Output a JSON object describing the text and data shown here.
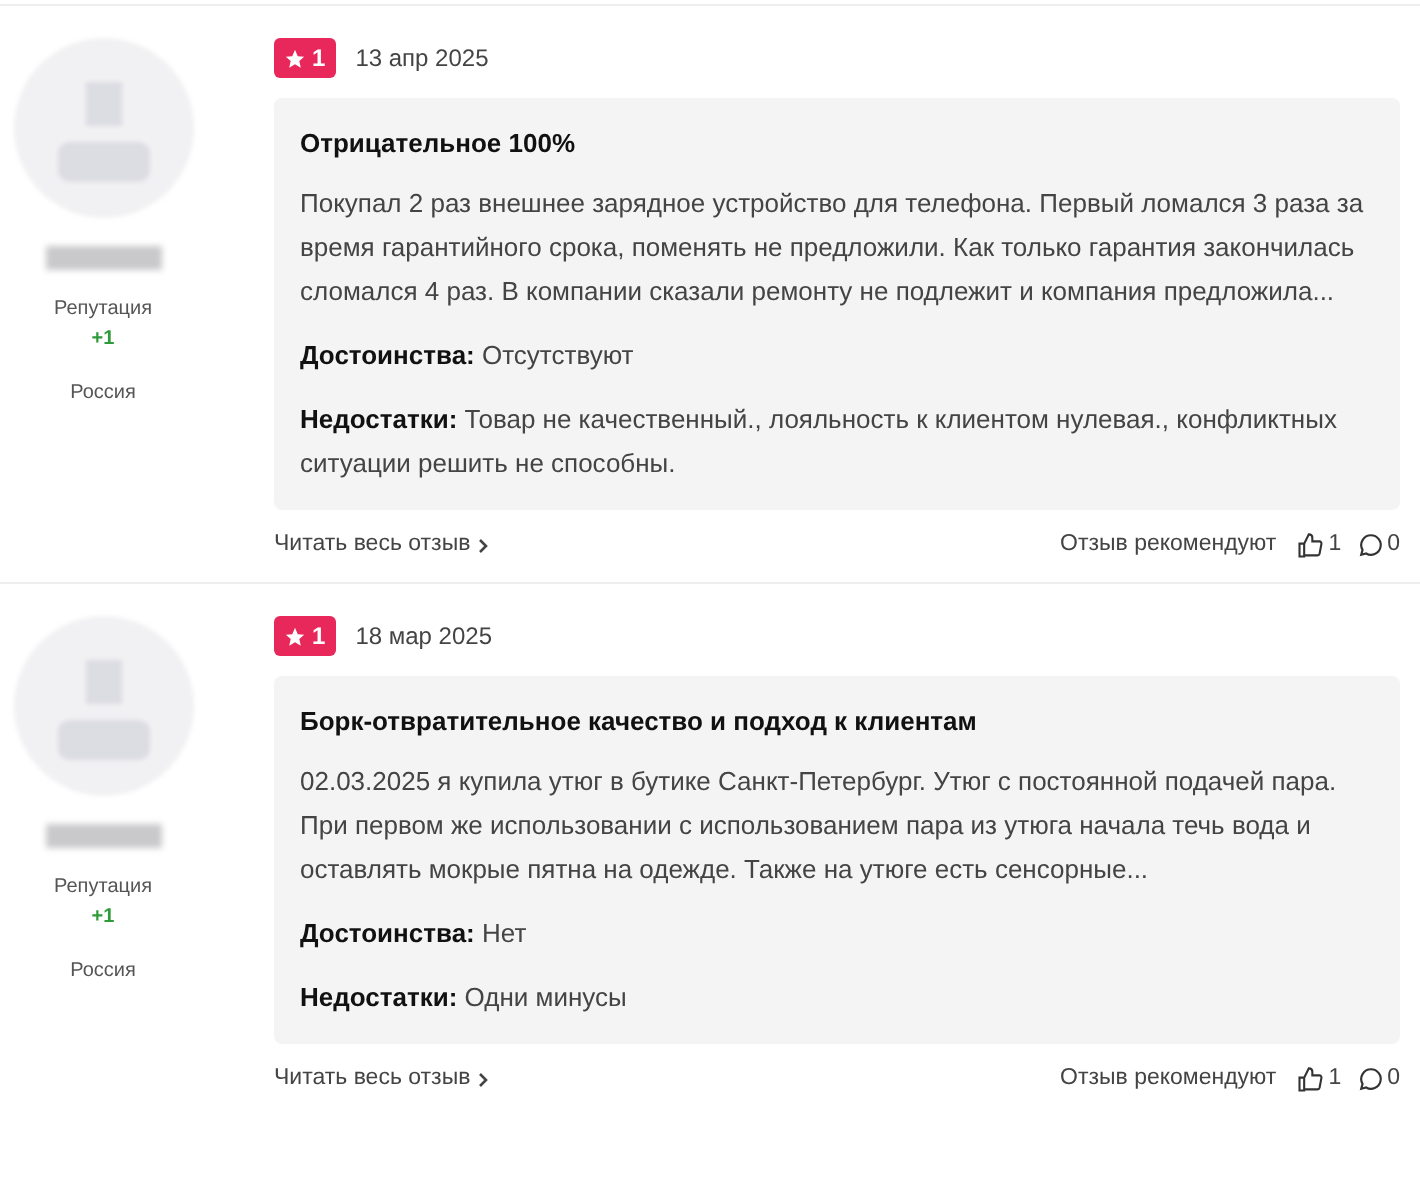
{
  "reviews": [
    {
      "author": {
        "reputation_label": "Репутация",
        "reputation": "+1",
        "country": "Россия"
      },
      "rating": "1",
      "date": "13 апр 2025",
      "title": "Отрицательное 100%",
      "text": "Покупал 2 раз внешнее зарядное устройство для телефона. Первый ломался 3 раза за время гарантийного срока, поменять не предложили. Как только гарантия закончилась сломался 4 раз. В компании сказали ремонту не подлежит и компания предложила...",
      "pros_label": "Достоинства:",
      "pros": "Отсутствуют",
      "cons_label": "Недостатки:",
      "cons": "Товар не качественный., лояльность к клиентом нулевая., конфликтных ситуации решить не способны.",
      "read_more": "Читать весь отзыв",
      "recommend_label": "Отзыв рекомендуют",
      "likes": "1",
      "comments": "0"
    },
    {
      "author": {
        "reputation_label": "Репутация",
        "reputation": "+1",
        "country": "Россия"
      },
      "rating": "1",
      "date": "18 мар 2025",
      "title": "Борк-отвратительное качество и подход к клиентам",
      "text": "02.03.2025 я купила утюг в бутике Санкт-Петербург. Утюг с постоянной подачей пара. При первом же использовании с использованием пара из утюга начала течь вода и оставлять мокрые пятна на одежде. Также на утюге есть сенсорные...",
      "pros_label": "Достоинства:",
      "pros": "Нет",
      "cons_label": "Недостатки:",
      "cons": "Одни минусы",
      "read_more": "Читать весь отзыв",
      "recommend_label": "Отзыв рекомендуют",
      "likes": "1",
      "comments": "0"
    }
  ]
}
